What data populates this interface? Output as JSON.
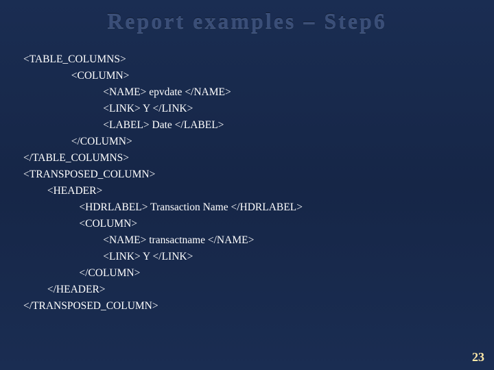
{
  "title": "Report examples – Step6",
  "code": "<TABLE_COLUMNS>\n                  <COLUMN>\n                              <NAME> epvdate </NAME>\n                              <LINK> Y </LINK>\n                              <LABEL> Date </LABEL>\n                  </COLUMN>\n</TABLE_COLUMNS>\n<TRANSPOSED_COLUMN>\n         <HEADER>\n                     <HDRLABEL> Transaction Name </HDRLABEL>\n                     <COLUMN>\n                              <NAME> transactname </NAME>\n                              <LINK> Y </LINK>\n                     </COLUMN>\n         </HEADER>\n</TRANSPOSED_COLUMN>",
  "pageNumber": "23"
}
